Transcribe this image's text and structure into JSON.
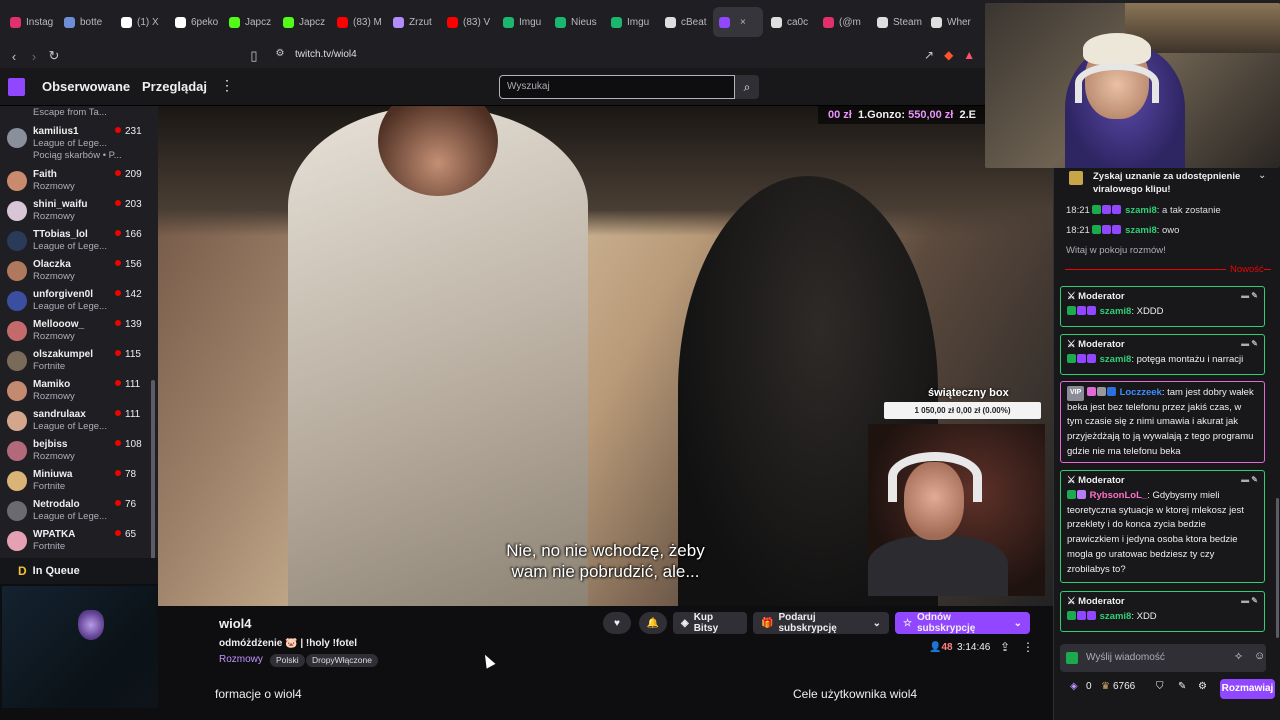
{
  "browser": {
    "tabs": [
      {
        "label": "Instag",
        "color": "#e1306c"
      },
      {
        "label": "botte",
        "color": "#6e8fd6"
      },
      {
        "label": "(1) X",
        "color": "#ffffff"
      },
      {
        "label": "6peko",
        "color": "#ffffff"
      },
      {
        "label": "Japcz",
        "color": "#53fc18"
      },
      {
        "label": "Japcz",
        "color": "#53fc18"
      },
      {
        "label": "(83) M",
        "color": "#ff0000"
      },
      {
        "label": "Zrzut",
        "color": "#b18cff"
      },
      {
        "label": "(83) V",
        "color": "#ff0000"
      },
      {
        "label": "Imgu",
        "color": "#1bb76e"
      },
      {
        "label": "Nieus",
        "color": "#1bb76e"
      },
      {
        "label": "Imgu",
        "color": "#1bb76e"
      },
      {
        "label": "cBeat",
        "color": "#dedede"
      },
      {
        "label": "",
        "color": "#9147ff"
      },
      {
        "label": "ca0c",
        "color": "#dedede"
      },
      {
        "label": "(@m",
        "color": "#e1306c"
      },
      {
        "label": "Steam",
        "color": "#dedede"
      },
      {
        "label": "Wher",
        "color": "#dedede"
      }
    ],
    "url": "twitch.tv/wiol4"
  },
  "nav": {
    "following": "Obserwowane",
    "browse": "Przeglądaj",
    "more": "⋮",
    "search_placeholder": "Wyszukaj"
  },
  "sidebar": {
    "partial_game": "Escape from Ta...",
    "channels": [
      {
        "name": "kamilius1",
        "game": "League of Lege...",
        "viewers": "231",
        "extra": "Pociąg skarbów • P...",
        "color": "#8a8f9c"
      },
      {
        "name": "Faith",
        "game": "Rozmowy",
        "viewers": "209",
        "color": "#c98a6e"
      },
      {
        "name": "shini_waifu",
        "game": "Rozmowy",
        "viewers": "203",
        "color": "#d8c6d6"
      },
      {
        "name": "TTobias_lol",
        "game": "League of Lege...",
        "viewers": "166",
        "color": "#2a3a5a"
      },
      {
        "name": "Olaczka",
        "game": "Rozmowy",
        "viewers": "156",
        "color": "#b0785c"
      },
      {
        "name": "unforgiven0l",
        "game": "League of Lege...",
        "viewers": "142",
        "color": "#3b4fa0"
      },
      {
        "name": "Mellooow_",
        "game": "Rozmowy",
        "viewers": "139",
        "color": "#c46a6a"
      },
      {
        "name": "olszakumpel",
        "game": "Fortnite",
        "viewers": "115",
        "color": "#7a6a5a"
      },
      {
        "name": "Mamiko",
        "game": "Rozmowy",
        "viewers": "111",
        "color": "#c48a70"
      },
      {
        "name": "sandrulaax",
        "game": "League of Lege...",
        "viewers": "111",
        "color": "#d4a68c"
      },
      {
        "name": "bejbiss",
        "game": "Rozmowy",
        "viewers": "108",
        "color": "#b26a7a"
      },
      {
        "name": "Miniuwa",
        "game": "Fortnite",
        "viewers": "78",
        "color": "#d9b476"
      },
      {
        "name": "Netrodalo",
        "game": "League of Lege...",
        "viewers": "76",
        "color": "#6a6a70"
      },
      {
        "name": "WPATKA",
        "game": "Fortnite",
        "viewers": "65",
        "color": "#e6a0b4"
      }
    ]
  },
  "mini_player": {
    "icon": "D",
    "title": "In Queue"
  },
  "video": {
    "ad_prefix": "00 zł",
    "ad_leader": "1.Gonzo: ",
    "ad_amount": "550,00 zł",
    "ad_next": "2.E",
    "box_title": "świąteczny box",
    "box_progress": "1 050,00 zł  0,00 zł (0.00%)",
    "subtitle_line1": "Nie, no nie wchodzę, żeby",
    "subtitle_line2": "wam nie pobrudzić, ale..."
  },
  "stream": {
    "username": "wiol4",
    "title": "odmóżdżenie 🐷 | !holy !fotel",
    "category": "Rozmowy",
    "tags": [
      "Polski",
      "DropyWłączone"
    ],
    "bits_label": "Kup Bitsy",
    "gift_label": "Podaruj subskrypcję",
    "resub_label": "Odnów subskrypcję",
    "viewers": "48",
    "uptime": "3:14:46",
    "about": "formacje o wiol4",
    "goals": "Cele użytkownika wiol4"
  },
  "chat": {
    "pinned": "Zyskaj uznanie za udostępnienie viralowego klipu!",
    "lines": [
      {
        "time": "18:21",
        "user": "szami8",
        "text": ": a tak zostanie"
      },
      {
        "time": "18:21",
        "user": "szami8",
        "text": ": owo"
      }
    ],
    "welcome": "Witaj w pokoju rozmów!",
    "new_label": "Nowość",
    "messages": [
      {
        "header": "Moderator",
        "user": "szami8",
        "text": ": XDDD"
      },
      {
        "header": "Moderator",
        "user": "szami8",
        "text": ": potęga montażu i narracji"
      },
      {
        "vip": "VIP",
        "user": "Loczzeek",
        "text": ": tam jest dobry wałek beka jest bez telefonu przez jakiś czas, w tym czasie się z nimi umawia i akurat jak przyjeżdżają to ją wywalają z tego programu gdzie nie ma telefonu beka"
      },
      {
        "header": "Moderator",
        "user": "RybsonLoL_",
        "text": ": Gdybysmy mieli teoretyczna sytuacje w ktorej mlekosz jest przeklety i do konca zycia bedzie prawiczkiem i jedyna osoba ktora bedzie mogla go uratowac bedziesz ty czy zrobilabys to?"
      },
      {
        "header": "Moderator",
        "user": "szami8",
        "text": ": XDD"
      }
    ],
    "input_placeholder": "Wyślij wiadomość",
    "bits": "0",
    "points": "6766",
    "send_label": "Rozmawiaj"
  }
}
